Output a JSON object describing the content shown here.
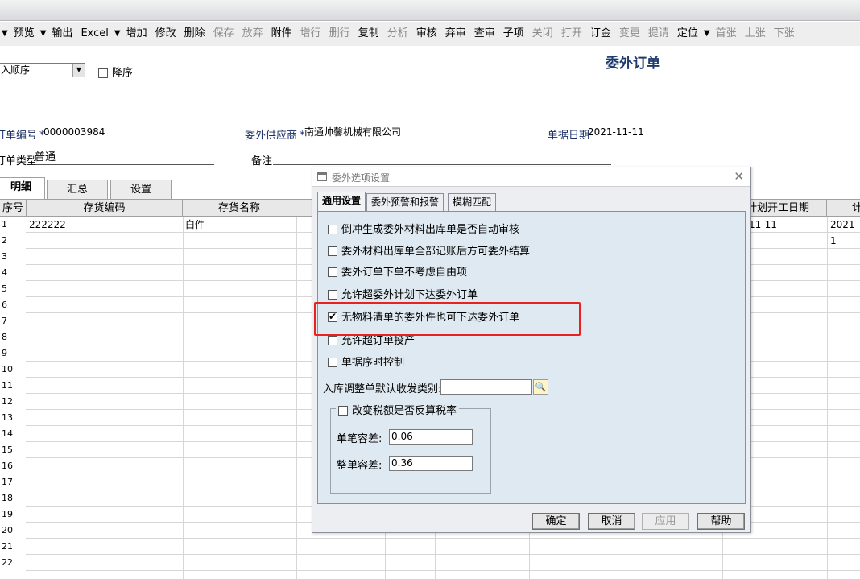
{
  "toolbar": {
    "items": [
      {
        "label": "▼",
        "dis": false,
        "caret": true
      },
      {
        "label": "预览",
        "dis": false
      },
      {
        "label": "▼",
        "dis": false,
        "caret": true
      },
      {
        "label": "输出",
        "dis": false
      },
      {
        "label": "Excel",
        "dis": false
      },
      {
        "label": "▼",
        "dis": false,
        "caret": true
      },
      {
        "label": "增加",
        "dis": false
      },
      {
        "label": "修改",
        "dis": false
      },
      {
        "label": "删除",
        "dis": false
      },
      {
        "label": "保存",
        "dis": true
      },
      {
        "label": "放弃",
        "dis": true
      },
      {
        "label": "附件",
        "dis": false
      },
      {
        "label": "增行",
        "dis": true
      },
      {
        "label": "删行",
        "dis": true
      },
      {
        "label": "复制",
        "dis": false
      },
      {
        "label": "分析",
        "dis": true
      },
      {
        "label": "审核",
        "dis": false
      },
      {
        "label": "弃审",
        "dis": false
      },
      {
        "label": "查审",
        "dis": false
      },
      {
        "label": "子项",
        "dis": false
      },
      {
        "label": "关闭",
        "dis": true
      },
      {
        "label": "打开",
        "dis": true
      },
      {
        "label": "订金",
        "dis": false
      },
      {
        "label": "变更",
        "dis": true
      },
      {
        "label": "提请",
        "dis": true
      },
      {
        "label": "定位",
        "dis": false
      },
      {
        "label": "▼",
        "dis": false,
        "caret": true
      },
      {
        "label": "首张",
        "dis": true
      },
      {
        "label": "上张",
        "dis": true
      },
      {
        "label": "下张",
        "dis": true
      }
    ]
  },
  "form": {
    "order_select": "入顺序",
    "desc_label": "降序",
    "title": "委外订单",
    "order_no_label": "订单编号",
    "order_no": "0000003984",
    "supplier_label": "委外供应商",
    "supplier": "南通帅馨机械有限公司",
    "date_label": "单据日期",
    "date": "2021-11-11",
    "type_label": "订单类型",
    "type": "普通",
    "remark_label": "备注",
    "required_mark": "*"
  },
  "tabs": [
    "明细",
    "汇总",
    "设置"
  ],
  "grid": {
    "headers": [
      "序号",
      "存货编码",
      "存货名称",
      "计划开工日期",
      "计"
    ],
    "first_row": {
      "code": "222222",
      "name": "白件",
      "start": "11-11",
      "end": "2021-1"
    },
    "row_numbers": [
      "1",
      "2",
      "3",
      "4",
      "5",
      "6",
      "7",
      "8",
      "9",
      "10",
      "11",
      "12",
      "13",
      "14",
      "15",
      "16",
      "17",
      "18",
      "19",
      "20",
      "21",
      "22"
    ]
  },
  "dialog": {
    "title": "委外选项设置",
    "tabs": [
      "通用设置",
      "委外预警和报警",
      "模糊匹配"
    ],
    "options": [
      {
        "label": "倒冲生成委外材料出库单是否自动审核",
        "checked": false
      },
      {
        "label": "委外材料出库单全部记账后方可委外结算",
        "checked": false
      },
      {
        "label": "委外订单下单不考虑自由项",
        "checked": false
      },
      {
        "label": "允许超委外计划下达委外订单",
        "checked": false
      },
      {
        "label": "无物料清单的委外件也可下达委外订单",
        "checked": true
      },
      {
        "label": "允许超订单投产",
        "checked": false
      },
      {
        "label": "单据序时控制",
        "checked": false
      }
    ],
    "inbound_label": "入库调整单默认收发类别:",
    "group_label": "改变税额是否反算税率",
    "single_tol_label": "单笔容差:",
    "single_tol": "0.06",
    "whole_tol_label": "整单容差:",
    "whole_tol": "0.36",
    "buttons": {
      "ok": "确定",
      "cancel": "取消",
      "apply": "应用",
      "help": "帮助"
    }
  }
}
